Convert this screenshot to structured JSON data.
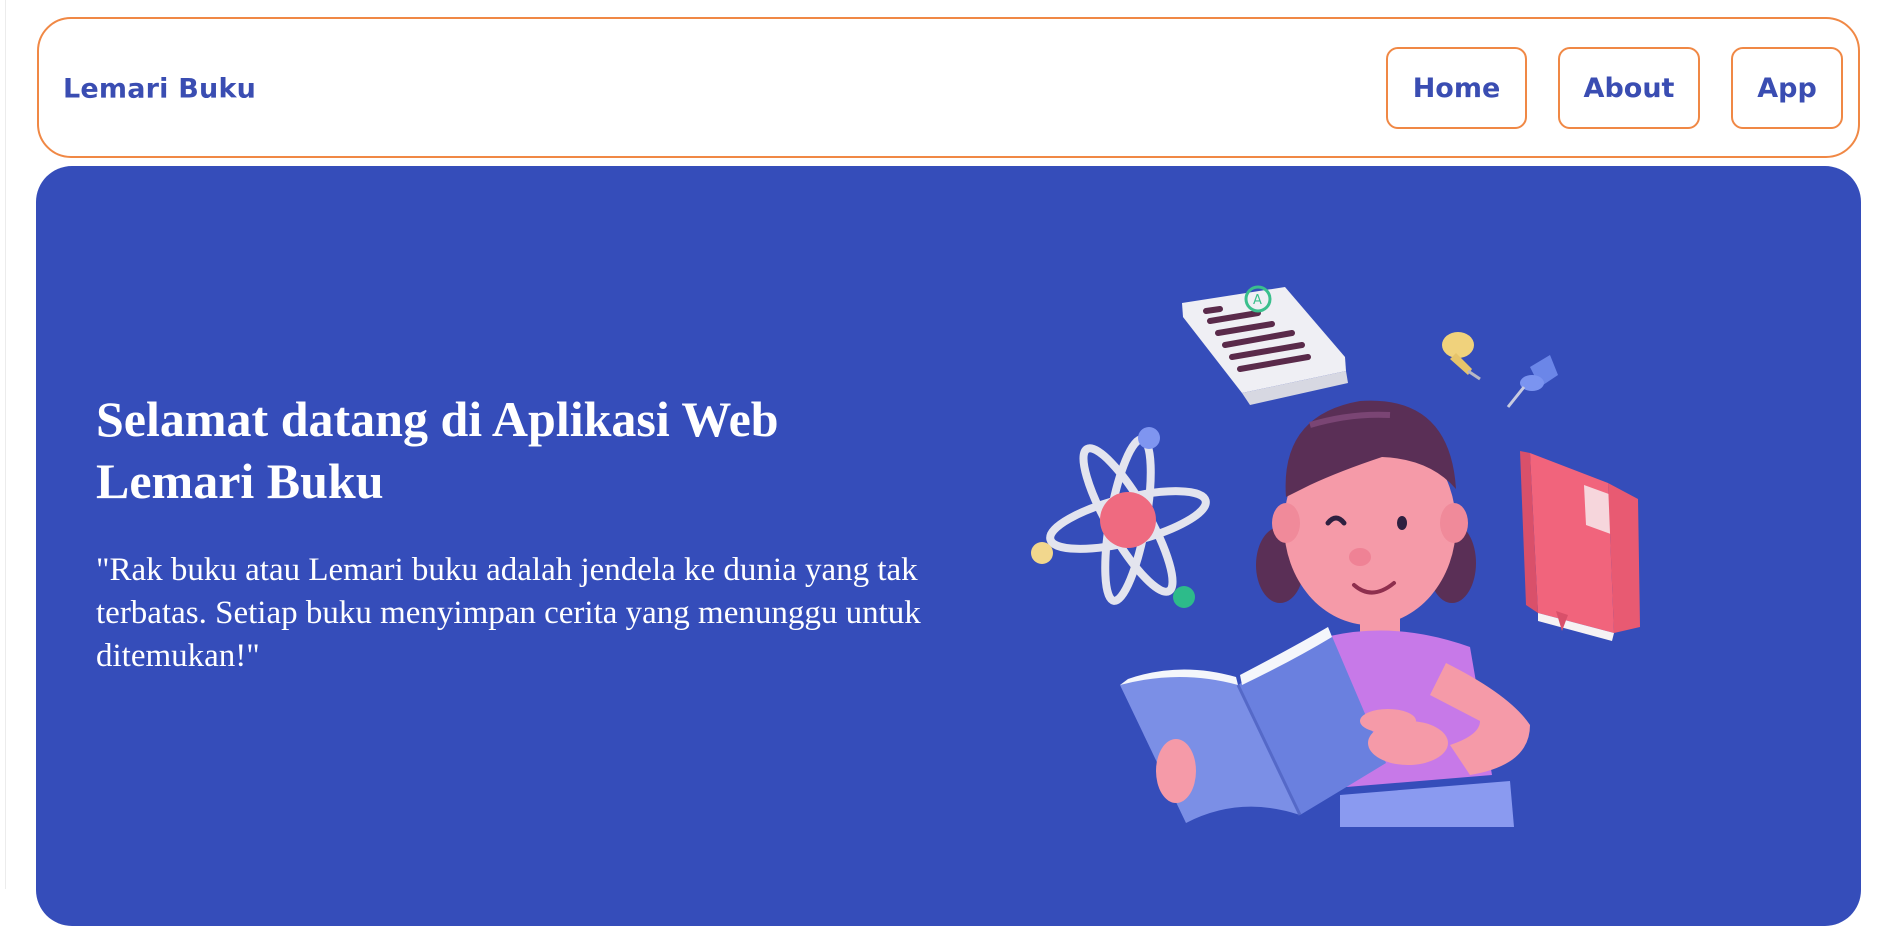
{
  "navbar": {
    "brand": "Lemari Buku",
    "items": [
      {
        "label": "Home"
      },
      {
        "label": "About"
      },
      {
        "label": "App"
      }
    ]
  },
  "hero": {
    "title": "Selamat datang di Aplikasi Web Lemari Buku",
    "quote": "\"Rak buku atau Lemari buku adalah jendela ke dunia yang tak terbatas. Setiap buku menyimpan cerita yang menunggu untuk ditemukan!\"",
    "illustration": "girl-reading-book-illustration"
  },
  "colors": {
    "accent_border": "#f08845",
    "brand_text": "#3a4db2",
    "hero_background": "#354dba",
    "hero_text": "#ffffff"
  }
}
